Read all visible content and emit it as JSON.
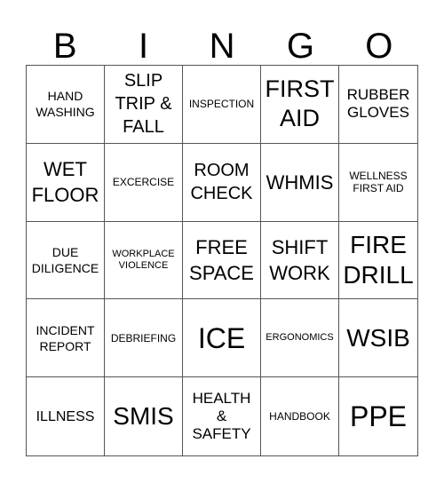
{
  "header": {
    "letters": [
      "B",
      "I",
      "N",
      "G",
      "O"
    ]
  },
  "cells": [
    {
      "text": "HAND\nWASHING"
    },
    {
      "text": "SLIP\nTRIP &\nFALL"
    },
    {
      "text": "INSPECTION"
    },
    {
      "text": "FIRST\nAID"
    },
    {
      "text": "RUBBER\nGLOVES"
    },
    {
      "text": "WET\nFLOOR"
    },
    {
      "text": "EXCERCISE"
    },
    {
      "text": "ROOM\nCHECK"
    },
    {
      "text": "WHMIS"
    },
    {
      "text": "WELLNESS\nFIRST AID"
    },
    {
      "text": "DUE\nDILIGENCE"
    },
    {
      "text": "WORKPLACE\nVIOLENCE"
    },
    {
      "text": "FREE\nSPACE"
    },
    {
      "text": "SHIFT\nWORK"
    },
    {
      "text": "FIRE\nDRILL"
    },
    {
      "text": "INCIDENT\nREPORT"
    },
    {
      "text": "DEBRIEFING"
    },
    {
      "text": "ICE"
    },
    {
      "text": "ERGONOMICS"
    },
    {
      "text": "WSIB"
    },
    {
      "text": "ILLNESS"
    },
    {
      "text": "SMIS"
    },
    {
      "text": "HEALTH\n&\nSAFETY"
    },
    {
      "text": "HANDBOOK"
    },
    {
      "text": "PPE"
    }
  ]
}
